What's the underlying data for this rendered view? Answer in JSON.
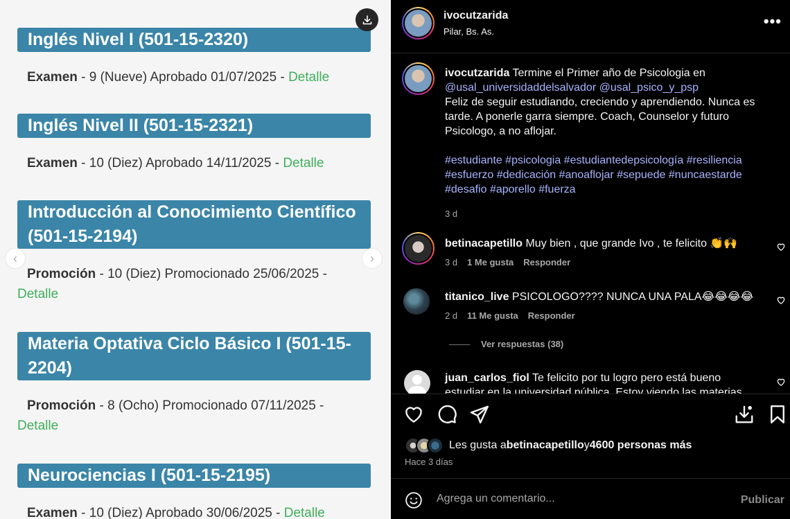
{
  "record": {
    "courses": [
      {
        "title": "Inglés Nivel I (501-15-2320)",
        "kind": "Examen",
        "result": " - 9 (Nueve) Aprobado 01/07/2025 - ",
        "detail": "Detalle"
      },
      {
        "title": "Inglés Nivel II (501-15-2321)",
        "kind": "Examen",
        "result": " - 10 (Diez) Aprobado 14/11/2025 - ",
        "detail": "Detalle"
      },
      {
        "title": "Introducción al Conocimiento Científico (501-15-2194)",
        "kind": "Promoción",
        "result": " - 10 (Diez) Promocionado 25/06/2025 - ",
        "detail": "Detalle"
      },
      {
        "title": "Materia Optativa Ciclo Básico I (501-15-2204)",
        "kind": "Promoción",
        "result": " - 8 (Ocho) Promocionado 07/11/2025 - ",
        "detail": "Detalle"
      },
      {
        "title": "Neurociencias I (501-15-2195)",
        "kind": "Examen",
        "result": " - 10 (Diez) Aprobado 30/06/2025 - ",
        "detail": "Detalle"
      }
    ],
    "prev_arrow": "‹",
    "next_arrow": "›"
  },
  "post": {
    "username": "ivocutzarida",
    "location": "Pilar, Bs. As.",
    "more": "•••",
    "caption": {
      "username": "ivocutzarida",
      "text1": " Termine el Primer año de Psicologia en ",
      "mention1": "@usal_universidaddelsalvador",
      "mention2": "@usal_psico_y_psp",
      "text2": "Feliz de seguir estudiando, creciendo y aprendiendo. Nunca es tarde. A ponerle garra siempre. Coach, Counselor y futuro Psicologo, a no aflojar.",
      "hashtags": "#estudiante #psicologia #estudiantedepsicología #resiliencia #esfuerzo #dedicación #anoaflojar #sepuede #nuncaestarde #desafio #aporello #fuerza",
      "ago": "3 d"
    },
    "comments": [
      {
        "username": "betinacapetillo",
        "text": " Muy bien , que grande Ivo , te felicito 👏🙌",
        "ago": "3 d",
        "likes": "1 Me gusta",
        "reply": "Responder"
      },
      {
        "username": "titanico_live",
        "text": " PSICOLOGO???? NUNCA UNA PALA😂😂😂😂",
        "ago": "2 d",
        "likes": "11 Me gusta",
        "reply": "Responder"
      },
      {
        "username": "juan_carlos_fiol",
        "text": " Te felicito por tu logro pero está bueno",
        "text_cut": "estudiar en la universidad pública. Estoy viendo las materias"
      }
    ],
    "view_replies": "Ver respuestas (38)",
    "likes_prefix": "Les gusta a ",
    "likes_user": "betinacapetillo",
    "likes_mid": " y ",
    "likes_rest": "4600 personas más",
    "when": "Hace 3 días",
    "comment_placeholder": "Agrega un comentario...",
    "publish": "Publicar"
  },
  "colors": {
    "accent_tag": "#a8b4ff",
    "course_header": "#3a85a8",
    "detail_link": "#3fae5a"
  }
}
